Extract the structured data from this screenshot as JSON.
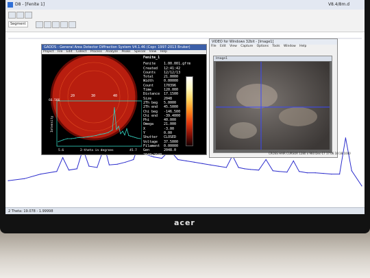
{
  "window": {
    "title": "D8 - [Fenite 1]",
    "version": "V8.4/8m.d"
  },
  "toolbar": {
    "segment_label": "Segment"
  },
  "gadds": {
    "title": "GADDS - General Area Detector Diffraction System V4.1.46 (Copr. 1997-2013 Bruker)",
    "menu": [
      "Project",
      "File",
      "Edit",
      "Collect",
      "Process",
      "Analyze",
      "Peaks",
      "Special",
      "View",
      "Help"
    ],
    "frame_name": "Fenite_1",
    "info": [
      [
        "Fenite",
        "1.00.001.gfrm"
      ],
      [
        "Created",
        "12:41:42"
      ],
      [
        "Counts",
        "12/12/13"
      ],
      [
        "Total",
        "21.0000"
      ],
      [
        "Width",
        "0.00000"
      ],
      [
        "Count",
        "170396"
      ],
      [
        "Time",
        "120.000"
      ],
      [
        "Distance",
        "17.1500"
      ],
      [
        "Size",
        "2048"
      ],
      [
        "2Th beg",
        "5.0000"
      ],
      [
        "2Th end",
        "45.5000"
      ],
      [
        "Chi beg",
        "-146.500"
      ],
      [
        "Chi end",
        "-39.4000"
      ],
      [
        "Phi",
        "40.000"
      ],
      [
        "Omega",
        "21.000"
      ],
      [
        "X",
        "-3.00"
      ],
      [
        "Y",
        "0.00"
      ],
      [
        "Shutter",
        "CLOSED"
      ],
      [
        "Voltage",
        "37.5000"
      ],
      [
        "Filament",
        "0.00000"
      ],
      [
        "Gen",
        "2048.0"
      ]
    ],
    "info_tail": "2048x2048",
    "ring_tick_labels": [
      "20",
      "30",
      "40"
    ],
    "inset": {
      "ylabel": "Intensity",
      "xlabel": "2-theta in degrees",
      "x_min_label": "5.6",
      "x_max_label": "45.7",
      "y_top_label": "66.566"
    }
  },
  "video": {
    "title": "VIDEO for Windows 32bit - [Image1]",
    "menu": [
      "File",
      "Edit",
      "View",
      "Capture",
      "Options",
      "Tools",
      "Window",
      "Help"
    ],
    "subwindow_title": "Image1",
    "status": "CROSS HAIR  CURSOR  1280 x 960  Dec-17  17:06  10:18:1000"
  },
  "taskbar": {
    "status": "2 Theta: 19.078 - 1.99998"
  },
  "monitor": {
    "brand": "acer"
  },
  "colors": {
    "pattern": "#2a2bcc",
    "inset_curve": "#34d6c4",
    "detector": "#b81e0f",
    "title": "#3c5fa8"
  },
  "chart_data": [
    {
      "type": "line",
      "xlabel": "",
      "ylabel": "",
      "x": [
        4,
        8,
        12,
        16,
        17.5,
        19,
        21,
        22.5,
        24,
        26,
        27.8,
        29,
        31,
        33,
        35,
        36.5,
        38,
        40,
        42,
        44,
        46,
        48,
        50,
        52,
        54,
        56,
        58,
        59.5,
        61,
        62.5,
        64,
        66,
        67.8,
        69.5,
        71,
        73,
        74.6,
        76,
        78,
        80,
        82,
        84,
        86,
        87.5,
        89,
        91.5
      ],
      "y": [
        30,
        33,
        40,
        44,
        65,
        46,
        48,
        78,
        52,
        50,
        82,
        54,
        55,
        58,
        62,
        88,
        70,
        66,
        64,
        76,
        62,
        60,
        58,
        56,
        54,
        52,
        50,
        68,
        50,
        48,
        47,
        46,
        62,
        45,
        44,
        43,
        60,
        44,
        42,
        42,
        41,
        40,
        40,
        95,
        45,
        22
      ],
      "ylim": [
        0,
        100
      ]
    },
    {
      "type": "line",
      "xlabel": "2-theta in degrees",
      "ylabel": "Intensity",
      "x": [
        5.6,
        8,
        10,
        12,
        14,
        16,
        18,
        20,
        22,
        24,
        26,
        28,
        30,
        32,
        33,
        34,
        35,
        36,
        37,
        38,
        39,
        40,
        41,
        42,
        43,
        44,
        45.7
      ],
      "y": [
        5,
        8,
        10,
        10,
        11,
        12,
        12,
        13,
        14,
        15,
        17,
        18,
        20,
        24,
        60,
        25,
        30,
        18,
        22,
        16,
        26,
        15,
        14,
        13,
        12,
        11,
        10
      ],
      "ylim": [
        0,
        66.566
      ]
    }
  ]
}
